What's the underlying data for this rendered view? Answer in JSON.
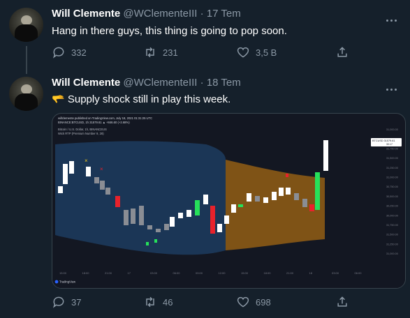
{
  "tweets": [
    {
      "name": "Will Clemente",
      "handle": "@WClementeIII",
      "dot": "·",
      "date": "17 Tem",
      "text": "Hang in there guys, this thing is going to pop soon.",
      "replies": "332",
      "retweets": "231",
      "likes": "3,5 B"
    },
    {
      "name": "Will Clemente",
      "handle": "@WClementeIII",
      "dot": "·",
      "date": "18 Tem",
      "emoji": "🫳",
      "text": "Supply shock still in play this week.",
      "replies": "37",
      "retweets": "46",
      "likes": "698"
    }
  ],
  "chart": {
    "header_line": "willclemente published on TradingView.com, July 18, 2021 01:31:25 UTC",
    "symbol_line": "BINANCE:BTCUSD, 1h  31579.61 ▲ +846.60 (+2.68%)",
    "title": "Bitcoin / U.S. Dollar, 1h, BINANCEUS",
    "subtitle": "Wick RTP (Premium Number 9, 28)",
    "price_badge": "BTCUSD 31579.61",
    "price_badge_sub": "30:17",
    "y_ticks": [
      "31,000.00",
      "32,000.00",
      "31,750.00",
      "31,500.00",
      "31,250.00",
      "31,000.00",
      "30,750.00",
      "30,500.00",
      "30,250.00",
      "30,000.00",
      "31,750.00",
      "31,500.00",
      "31,250.00",
      "31,000.00"
    ],
    "x_ticks": [
      "15:00",
      "18:00",
      "21:00",
      "17",
      "03:00",
      "06:00",
      "09:00",
      "12:00",
      "15:00",
      "18:00",
      "21:00",
      "18",
      "03:00",
      "06:00"
    ],
    "brand": "TradingView",
    "colors": {
      "up": "#26e05a",
      "down": "#e8222b",
      "neutral_up": "#ffffff",
      "neutral_down": "#8a8d94",
      "band_blue": "#1d3a5c",
      "band_orange": "#8c5a15"
    }
  }
}
